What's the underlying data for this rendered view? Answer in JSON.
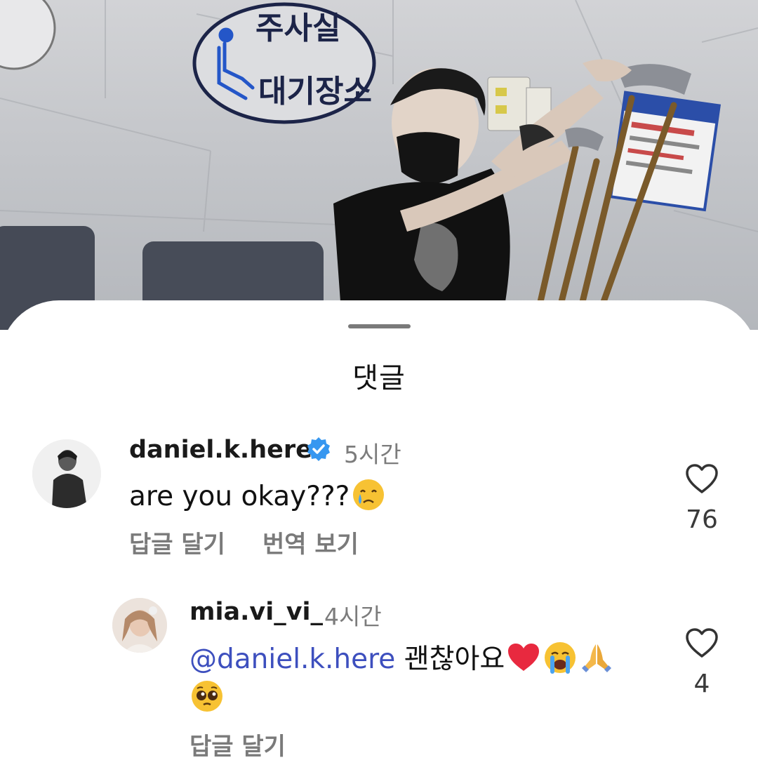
{
  "photo": {
    "sign_line1": "주사실",
    "sign_line2": "대기장소"
  },
  "sheet": {
    "title": "댓글"
  },
  "comments": [
    {
      "username": "daniel.k.here",
      "verified": true,
      "time": "5시간",
      "text": "are you okay???",
      "emojis": [
        "crying-face-emoji"
      ],
      "actions": [
        "답글 달기",
        "번역 보기"
      ],
      "likes": "76"
    },
    {
      "username": "mia.vi_vi_",
      "verified": false,
      "time": "4시간",
      "mention": "daniel.k.here",
      "text": "괜찮아요",
      "emojis": [
        "red-heart-emoji",
        "loudly-crying-face-emoji",
        "folded-hands-emoji",
        "pleading-face-emoji"
      ],
      "actions": [
        "답글 달기"
      ],
      "likes": "4"
    }
  ],
  "colors": {
    "mention": "#3d4fbe",
    "verified": "#3797f0",
    "muted": "#7a7a7a"
  }
}
